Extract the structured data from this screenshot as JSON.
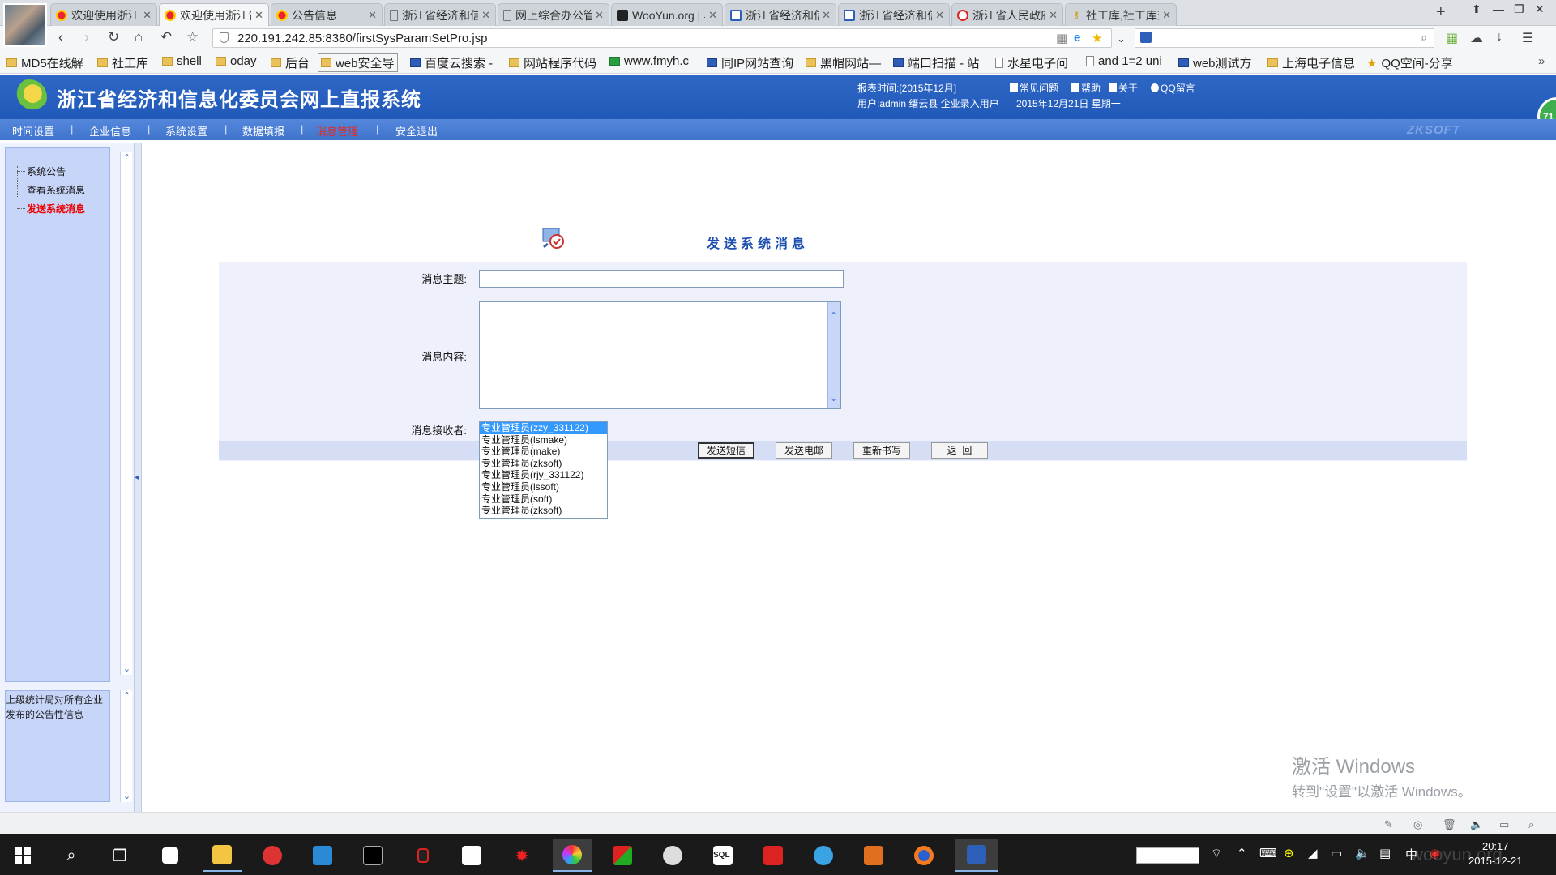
{
  "browser": {
    "tabs": [
      {
        "label": "欢迎使用浙江省经",
        "active": false
      },
      {
        "label": "欢迎使用浙江省经",
        "active": true
      },
      {
        "label": "公告信息",
        "active": false
      },
      {
        "label": "浙江省经济和信息",
        "active": false
      },
      {
        "label": "网上综合办公管理",
        "active": false
      },
      {
        "label": "WooYun.org | 乌",
        "active": false
      },
      {
        "label": "浙江省经济和信息",
        "active": false
      },
      {
        "label": "浙江省经济和信息",
        "active": false
      },
      {
        "label": "浙江省人民政府",
        "active": false
      },
      {
        "label": "社工库,社工库查询",
        "active": false
      }
    ],
    "url": "220.191.242.85:8380/firstSysParamSetPro.jsp",
    "bookmarks": [
      {
        "label": "MD5在线解",
        "icon": "folder"
      },
      {
        "label": "社工库",
        "icon": "folder"
      },
      {
        "label": "shell",
        "icon": "folder"
      },
      {
        "label": "oday",
        "icon": "folder"
      },
      {
        "label": "后台",
        "icon": "folder"
      },
      {
        "label": "web安全导",
        "icon": "folder"
      },
      {
        "label": "百度云搜索 -",
        "icon": "site"
      },
      {
        "label": "网站程序代码",
        "icon": "folder"
      },
      {
        "label": "www.fmyh.c",
        "icon": "site"
      },
      {
        "label": "同IP网站查询",
        "icon": "site"
      },
      {
        "label": "黑帽网站—",
        "icon": "folder"
      },
      {
        "label": "端口扫描 - 站",
        "icon": "site"
      },
      {
        "label": "水星电子问",
        "icon": "page"
      },
      {
        "label": "and 1=2 uni",
        "icon": "page"
      },
      {
        "label": "web测试方",
        "icon": "site"
      },
      {
        "label": "上海电子信息",
        "icon": "folder"
      },
      {
        "label": "QQ空间-分享",
        "icon": "star"
      }
    ]
  },
  "app": {
    "title": "浙江省经济和信息化委员会网上直报系统",
    "report_time": "报表时间:[2015年12月]",
    "user_line": "用户:admin 缙云县 企业录入用户",
    "date_line": "2015年12月21日 星期一",
    "header_links": [
      "常见问题",
      "帮助",
      "关于",
      "QQ留言"
    ],
    "badge": "71",
    "menu": [
      {
        "label": "时间设置",
        "active": false
      },
      {
        "label": "企业信息",
        "active": false
      },
      {
        "label": "系统设置",
        "active": false
      },
      {
        "label": "数据填报",
        "active": false
      },
      {
        "label": "消息管理",
        "active": true
      },
      {
        "label": "安全退出",
        "active": false
      }
    ],
    "brand_mark": "ZKSOFT"
  },
  "sidebar": {
    "items": [
      {
        "label": "系统公告",
        "active": false
      },
      {
        "label": "查看系统消息",
        "active": false
      },
      {
        "label": "发送系统消息",
        "active": true
      }
    ],
    "notice": "上级统计局对所有企业发布的公告性信息"
  },
  "form": {
    "title": "发送系统消息",
    "subject_label": "消息主题:",
    "subject_value": "",
    "content_label": "消息内容:",
    "content_value": "",
    "receiver_label": "消息接收者:",
    "receivers": [
      {
        "label": "专业管理员(zzy_331122)",
        "selected": true
      },
      {
        "label": "专业管理员(lsmake)",
        "selected": false
      },
      {
        "label": "专业管理员(make)",
        "selected": false
      },
      {
        "label": "专业管理员(zksoft)",
        "selected": false
      },
      {
        "label": "专业管理员(rjy_331122)",
        "selected": false
      },
      {
        "label": "专业管理员(lssoft)",
        "selected": false
      },
      {
        "label": "专业管理员(soft)",
        "selected": false
      },
      {
        "label": "专业管理员(zksoft)",
        "selected": false
      }
    ],
    "buttons": {
      "send_sms": "发送短信",
      "send_mail": "发送电邮",
      "reset": "重新书写",
      "back": "返  回"
    }
  },
  "os": {
    "watermark_line1": "激活 Windows",
    "watermark_line2": "转到\"设置\"以激活 Windows。",
    "clock_time": "20:17",
    "clock_date": "2015-12-21",
    "ime": "中",
    "site_watermark": "wooyun.org"
  },
  "colors": {
    "header_blue": "#2159b9",
    "menu_active": "#e52a20",
    "sidebar_active": "#e00000",
    "form_title": "#1d4fb0",
    "selected_option": "#3399ff"
  }
}
